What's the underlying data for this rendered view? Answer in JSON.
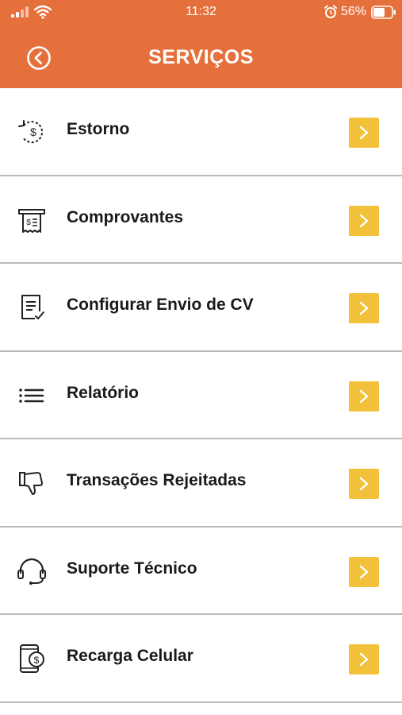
{
  "status_bar": {
    "time": "11:32",
    "battery_percent": "56%",
    "icons": [
      "signal-icon",
      "wifi-icon",
      "alarm-icon",
      "battery-icon"
    ]
  },
  "header": {
    "title": "SERVIÇOS",
    "back_icon": "back-circle-icon",
    "background_color": "#e5703b"
  },
  "menu": {
    "chevron_color": "#f2c13a",
    "items": [
      {
        "label": "Estorno",
        "icon": "refund-icon"
      },
      {
        "label": "Comprovantes",
        "icon": "receipt-icon"
      },
      {
        "label": "Configurar Envio de CV",
        "icon": "document-check-icon"
      },
      {
        "label": "Relatório",
        "icon": "list-icon"
      },
      {
        "label": "Transações Rejeitadas",
        "icon": "thumbs-down-icon"
      },
      {
        "label": "Suporte Técnico",
        "icon": "headset-icon"
      },
      {
        "label": "Recarga Celular",
        "icon": "phone-recharge-icon"
      }
    ]
  }
}
